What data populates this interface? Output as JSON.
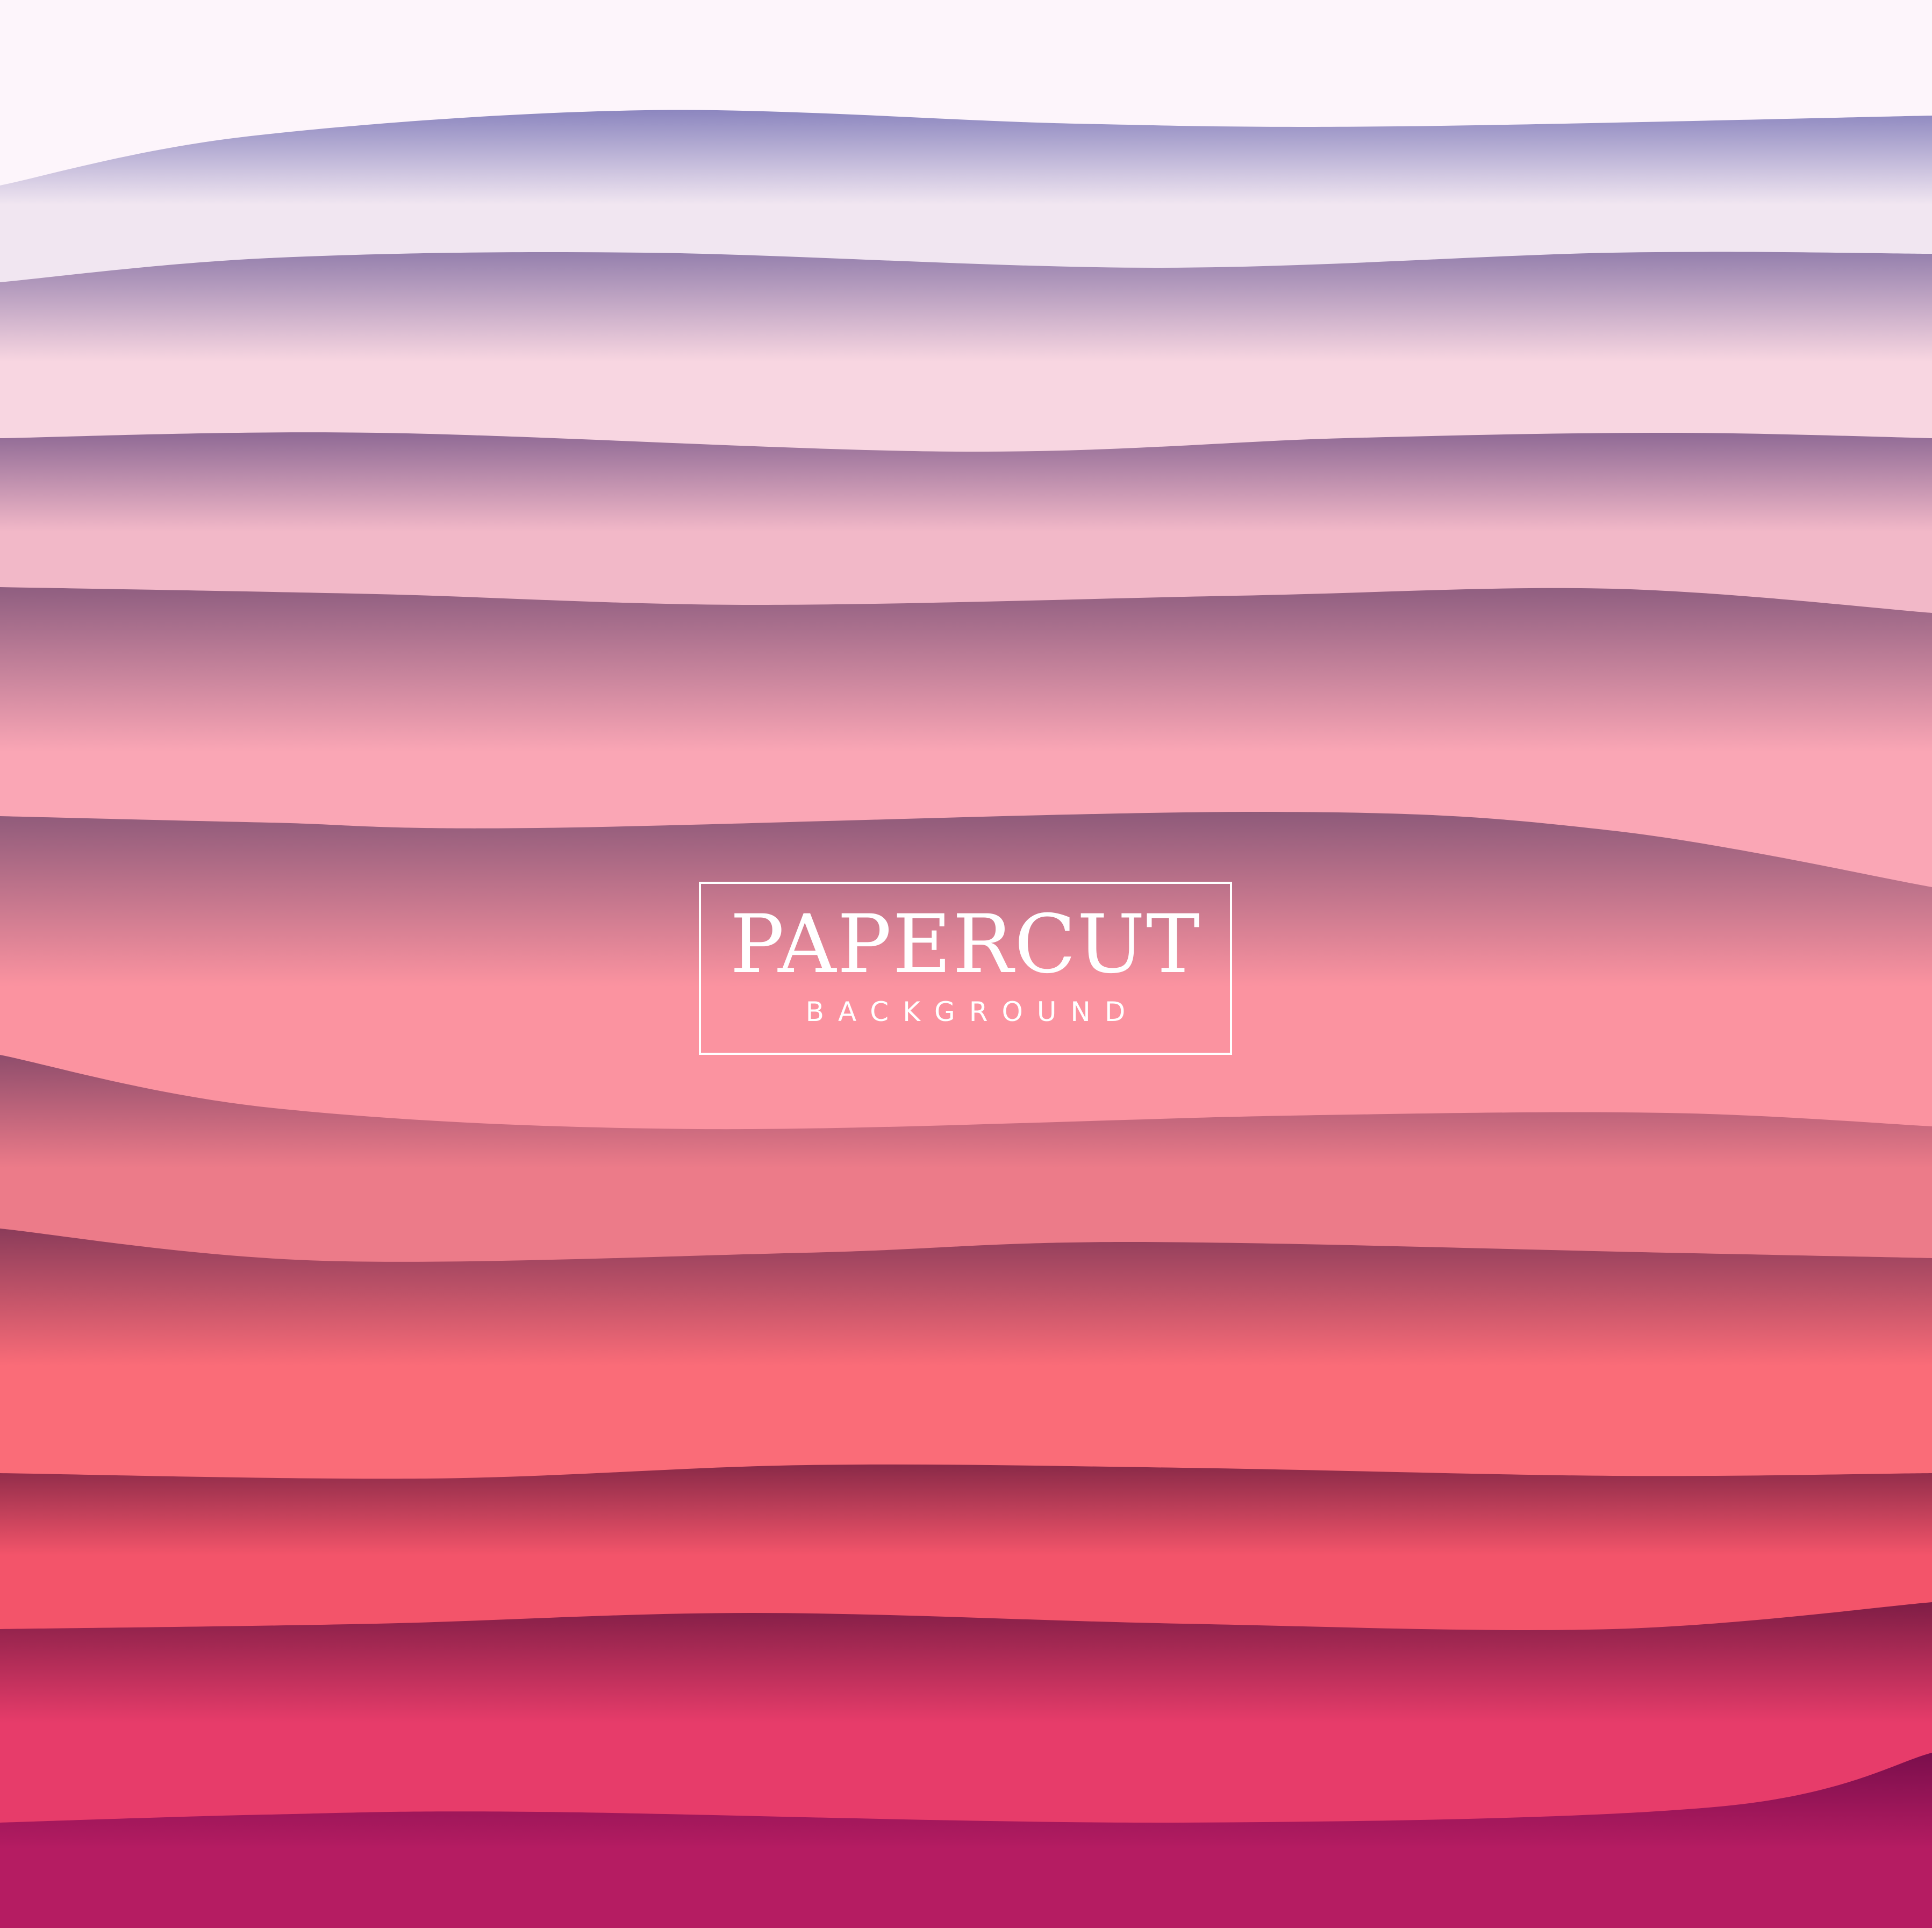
{
  "title": {
    "main": "PAPERCUT",
    "sub": "BACKGROUND"
  },
  "colors": {
    "top": "#fdf5fb",
    "layers": [
      "#f1e6f1",
      "#f8d6e1",
      "#f2b8c8",
      "#faa6b5",
      "#fb93a0",
      "#ec7b89",
      "#fa6c78",
      "#f3546a",
      "#e73c6a",
      "#b51c62"
    ],
    "shadow": [
      "#8c86bf",
      "#9580ad",
      "#8f6a95",
      "#8f5e80",
      "#8e5a7a",
      "#8f4d6c",
      "#8b3c5a",
      "#8a2a48",
      "#7e1d45",
      "#7a0e4c"
    ],
    "text": "#ffffff"
  },
  "image": {
    "style": "papercut-waves"
  }
}
